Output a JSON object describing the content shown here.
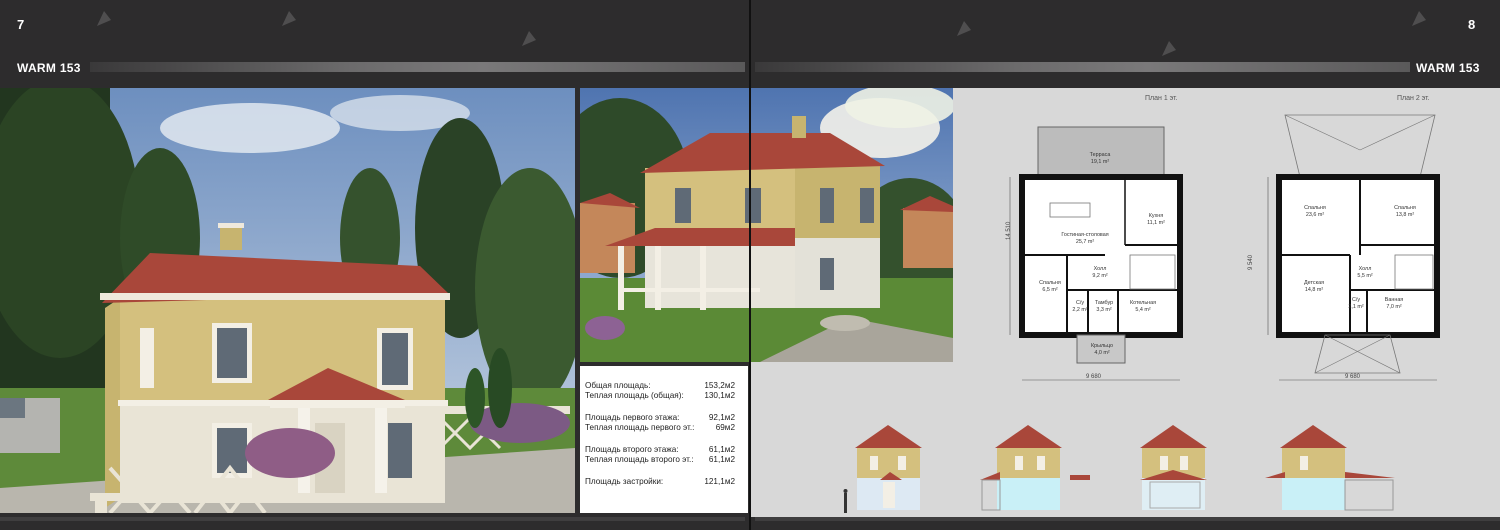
{
  "left_page": {
    "number": "7",
    "title": "WARM 153"
  },
  "right_page": {
    "number": "8",
    "title": "WARM 153"
  },
  "info": [
    {
      "label": "Общая площадь:",
      "value": "153,2м2"
    },
    {
      "label": "Теплая площадь (общая):",
      "value": "130,1м2"
    },
    {
      "label": "Площадь первого этажа:",
      "value": "92,1м2"
    },
    {
      "label": "Теплая площадь первого эт.:",
      "value": "69м2"
    },
    {
      "label": "Площадь второго этажа:",
      "value": "61,1м2"
    },
    {
      "label": "Теплая площадь второго эт.:",
      "value": "61,1м2"
    },
    {
      "label": "Площадь застройки:",
      "value": "121,1м2"
    }
  ],
  "plan1": {
    "title": "План 1 эт.",
    "width_dim": "9 680",
    "height_dim": "14 510",
    "rooms": [
      {
        "name": "Терраса",
        "area": "19,1 m²"
      },
      {
        "name": "Кухня",
        "area": "11,1 m²"
      },
      {
        "name": "Гостиная-столовая",
        "area": "25,7 m²"
      },
      {
        "name": "Холл",
        "area": "9,2 m²"
      },
      {
        "name": "Спальня",
        "area": "6,5 m²"
      },
      {
        "name": "С/у",
        "area": "2,2 m²"
      },
      {
        "name": "Тамбур",
        "area": "3,3 m²"
      },
      {
        "name": "Котельная",
        "area": "5,4 m²"
      },
      {
        "name": "Крыльцо",
        "area": "4,0 m²"
      }
    ]
  },
  "plan2": {
    "title": "План 2 эт.",
    "width_dim": "9 680",
    "height_dim": "9 540",
    "rooms": [
      {
        "name": "Спальня",
        "area": "23,6 m²"
      },
      {
        "name": "Спальня",
        "area": "13,8 m²"
      },
      {
        "name": "Холл",
        "area": "5,5 m²"
      },
      {
        "name": "Детская",
        "area": "14,8 m²"
      },
      {
        "name": "С/у",
        "area": "2,1 m²"
      },
      {
        "name": "Ванная",
        "area": "7,0 m²"
      }
    ]
  },
  "colors": {
    "facade": "#d4c07e",
    "roof": "#a9473a",
    "plinth": "#e9e4d6",
    "background": "#2d2c2d"
  }
}
